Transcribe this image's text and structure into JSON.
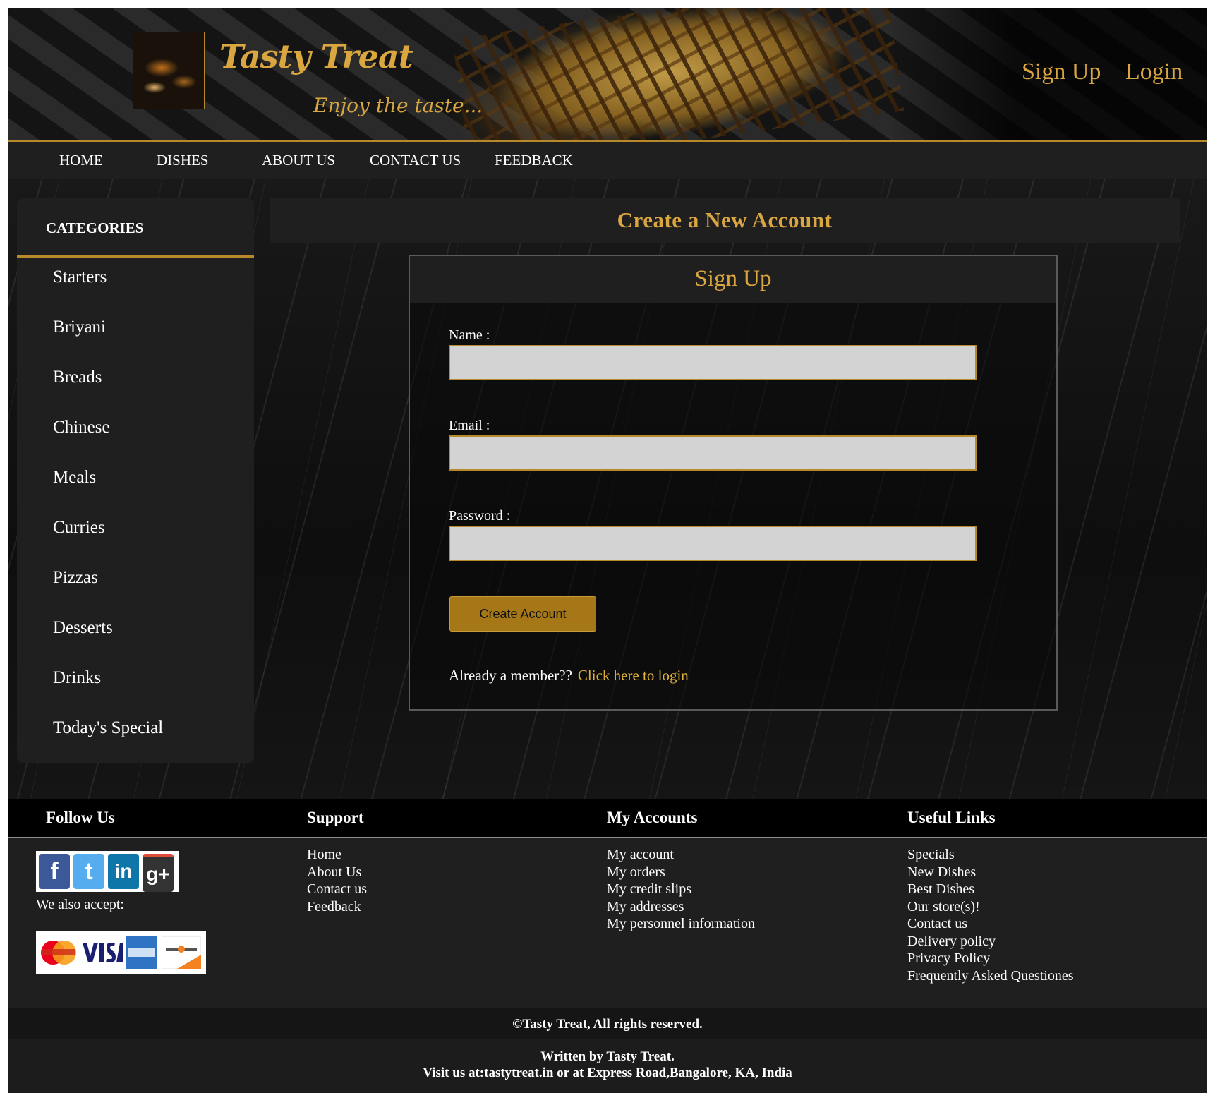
{
  "header": {
    "brand": "Tasty Treat",
    "tagline": "Enjoy the taste...",
    "signup": "Sign Up",
    "login": "Login"
  },
  "nav": [
    "HOME",
    "DISHES",
    "ABOUT US",
    "CONTACT US",
    "FEEDBACK"
  ],
  "sidebar": {
    "heading": "CATEGORIES",
    "items": [
      "Starters",
      "Briyani",
      "Breads",
      "Chinese",
      "Meals",
      "Curries",
      "Pizzas",
      "Desserts",
      "Drinks",
      "Today's Special"
    ]
  },
  "main": {
    "title": "Create a New Account",
    "form": {
      "heading": "Sign Up",
      "name_label": "Name :",
      "name_value": "",
      "email_label": "Email :",
      "email_value": "",
      "password_label": "Password :",
      "password_value": "",
      "submit": "Create Account",
      "member_text": "Already a member??",
      "login_link": "Click here to login"
    }
  },
  "footer": {
    "follow": {
      "title": "Follow Us",
      "accept": "We also accept:"
    },
    "support": {
      "title": "Support",
      "links": [
        "Home",
        "About Us",
        "Contact us",
        "Feedback"
      ]
    },
    "accounts": {
      "title": "My Accounts",
      "links": [
        "My account",
        "My orders",
        "My credit slips",
        "My addresses",
        "My personnel information"
      ]
    },
    "useful": {
      "title": "Useful Links",
      "links": [
        "Specials",
        "New Dishes",
        "Best Dishes",
        "Our store(s)!",
        "Contact us",
        "Delivery policy",
        "Privacy Policy",
        "Frequently Asked Questiones"
      ]
    },
    "copyright": "©Tasty Treat, All rights reserved.",
    "written": "Written by Tasty Treat.",
    "visit": "Visit us at:tastytreat.in or at Express Road,Bangalore, KA, India"
  },
  "colors": {
    "accent": "#d9a640",
    "button": "#a57716",
    "panel": "#1f1f20"
  }
}
